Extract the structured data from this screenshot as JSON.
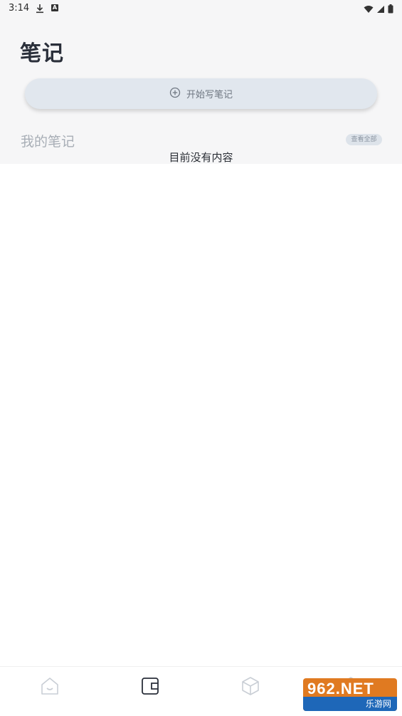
{
  "status_bar": {
    "time": "3:14",
    "a_label": "A"
  },
  "header": {
    "title": "笔记"
  },
  "start_button": {
    "label": "开始写笔记",
    "icon": "plus-circle-icon"
  },
  "my_notes": {
    "title": "我的笔记",
    "view_all": "查看全部",
    "empty": "目前没有内容"
  },
  "bottom_nav": {
    "items": [
      {
        "icon": "home-icon",
        "active": false
      },
      {
        "icon": "notebook-icon",
        "active": true
      },
      {
        "icon": "cube-icon",
        "active": false
      },
      {
        "icon": "profile-icon",
        "active": false
      }
    ]
  },
  "watermark": {
    "top": "962.NET",
    "bottom": "乐游网"
  },
  "colors": {
    "accent_button_bg": "#e1e7ee",
    "top_bg": "#f6f6f7",
    "watermark_orange": "#e07a21",
    "watermark_blue": "#1e67b8"
  }
}
